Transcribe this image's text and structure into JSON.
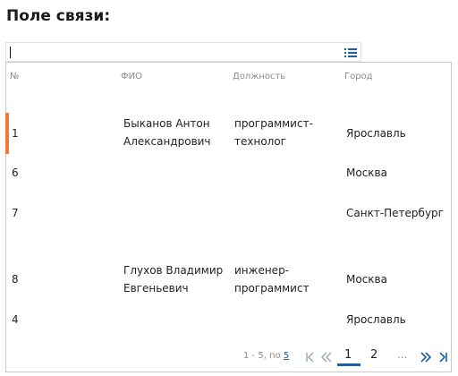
{
  "title": "Поле связи:",
  "field": {
    "value": ""
  },
  "table": {
    "columns": {
      "num": "№",
      "fio": "ФИО",
      "position": "Должность",
      "city": "Город"
    },
    "rows": [
      {
        "num": "1",
        "fio": "Быканов Антон\nАлександрович",
        "position": "программист-\nтехнолог",
        "city": "Ярославль",
        "marked": true
      },
      {
        "num": "6",
        "fio": "",
        "position": "",
        "city": "Москва",
        "marked": false
      },
      {
        "num": "7",
        "fio": "",
        "position": "",
        "city": "Санкт-Петербург",
        "marked": false
      },
      {
        "num": "8",
        "fio": "Глухов Владимир\nЕвгеньевич",
        "position": "инженер-\nпрограммист",
        "city": "Москва",
        "marked": false
      },
      {
        "num": "4",
        "fio": "",
        "position": "",
        "city": "Ярославль",
        "marked": false
      }
    ]
  },
  "pager": {
    "summary_prefix": "1 - 5, по",
    "page_size": "5",
    "pages": [
      "1",
      "2"
    ],
    "active_page": "1",
    "ellipsis": "...",
    "accent_color": "#1a5fa8",
    "marker_color": "#f07a3e"
  },
  "icons": {
    "list": "list-icon",
    "first": "first-page-icon",
    "prev": "prev-page-icon",
    "next": "next-page-icon",
    "last": "last-page-icon"
  }
}
